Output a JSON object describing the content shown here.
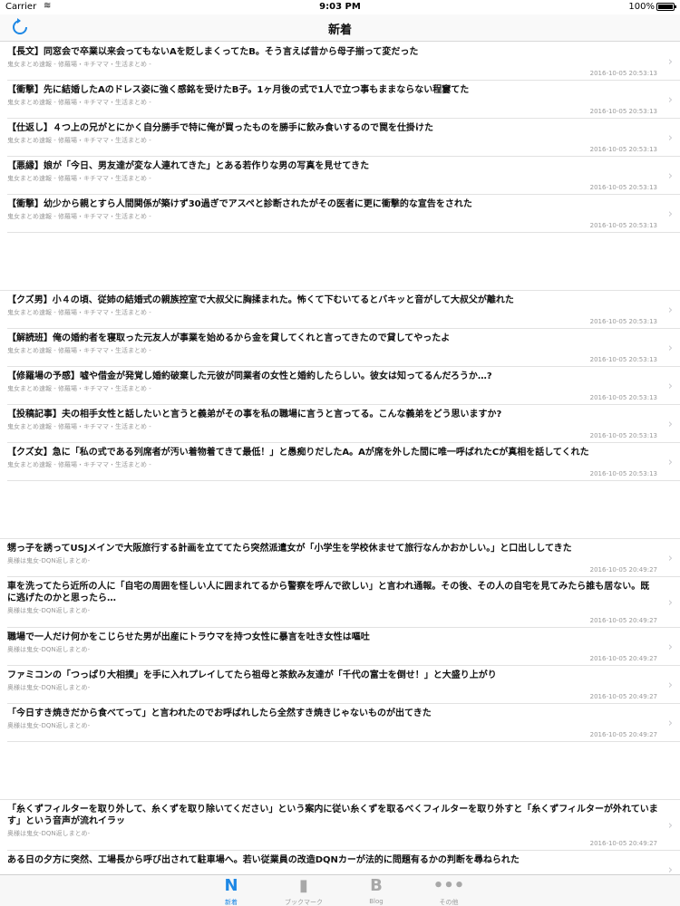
{
  "status": {
    "carrier": "Carrier",
    "time": "9:03 PM",
    "battery": "100%"
  },
  "nav": {
    "title": "新着"
  },
  "sections": [
    {
      "rows": [
        {
          "title": "【長文】同窓会で卒業以来会ってもないAを貶しまくってたB。そう言えば昔から母子揃って変だった",
          "source": "鬼女まとめ速報 - 修羅場・キチママ・生活まとめ -",
          "time": "2016-10-05 20:53:13"
        },
        {
          "title": "【衝撃】先に結婚したAのドレス姿に強く感銘を受けたB子。1ヶ月後の式で1人で立つ事もままならない程窶てた",
          "source": "鬼女まとめ速報 - 修羅場・キチママ・生活まとめ -",
          "time": "2016-10-05 20:53:13"
        },
        {
          "title": "【仕返し】４つ上の兄がとにかく自分勝手で特に俺が買ったものを勝手に飲み食いするので罠を仕掛けた",
          "source": "鬼女まとめ速報 - 修羅場・キチママ・生活まとめ -",
          "time": "2016-10-05 20:53:13"
        },
        {
          "title": "【悪縁】娘が「今日、男友達が変な人連れてきた」とある若作りな男の写真を見せてきた",
          "source": "鬼女まとめ速報 - 修羅場・キチママ・生活まとめ -",
          "time": "2016-10-05 20:53:13"
        },
        {
          "title": "【衝撃】幼少から親とすら人間関係が築けず30過ぎでアスペと診断されたがその医者に更に衝撃的な宣告をされた",
          "source": "鬼女まとめ速報 - 修羅場・キチママ・生活まとめ -",
          "time": "2016-10-05 20:53:13"
        }
      ]
    },
    {
      "rows": [
        {
          "title": "【クズ男】小４の頃、従姉の結婚式の親族控室で大叔父に胸揉まれた。怖くて下むいてるとバキッと音がして大叔父が離れた",
          "source": "鬼女まとめ速報 - 修羅場・キチママ・生活まとめ -",
          "time": "2016-10-05 20:53:13"
        },
        {
          "title": "【解読班】俺の婚約者を寝取った元友人が事業を始めるから金を貸してくれと言ってきたので貸してやったよ",
          "source": "鬼女まとめ速報 - 修羅場・キチママ・生活まとめ -",
          "time": "2016-10-05 20:53:13"
        },
        {
          "title": "【修羅場の予感】嘘や借金が発覚し婚約破棄した元彼が同業者の女性と婚約したらしい。彼女は知ってるんだろうか…?",
          "source": "鬼女まとめ速報 - 修羅場・キチママ・生活まとめ -",
          "time": "2016-10-05 20:53:13"
        },
        {
          "title": "【投稿記事】夫の相手女性と話したいと言うと義弟がその事を私の職場に言うと言ってる。こんな義弟をどう思いますか?",
          "source": "鬼女まとめ速報 - 修羅場・キチママ・生活まとめ -",
          "time": "2016-10-05 20:53:13"
        },
        {
          "title": "【クズ女】急に「私の式である列席者が汚い着物着てきて最低！」と愚痴りだしたA。Aが席を外した間に唯一呼ばれたCが真相を話してくれた",
          "source": "鬼女まとめ速報 - 修羅場・キチママ・生活まとめ -",
          "time": "2016-10-05 20:53:13"
        }
      ]
    },
    {
      "rows": [
        {
          "title": "甥っ子を誘ってUSJメインで大阪旅行する計画を立ててたら突然派遣女が「小学生を学校休ませて旅行なんかおかしい。」と口出ししてきた",
          "source": "奥様は鬼女-DQN返しまとめ-",
          "time": "2016-10-05 20:49:27"
        },
        {
          "title": "車を洗ってたら近所の人に「自宅の周囲を怪しい人に囲まれてるから警察を呼んで欲しい」と言われ通報。その後、その人の自宅を見てみたら誰も居ない。既に逃げたのかと思ったら…",
          "source": "奥様は鬼女-DQN返しまとめ-",
          "time": "2016-10-05 20:49:27",
          "tall": true
        },
        {
          "title": "職場で一人だけ何かをこじらせた男が出産にトラウマを持つ女性に暴言を吐き女性は嘔吐",
          "source": "奥様は鬼女-DQN返しまとめ-",
          "time": "2016-10-05 20:49:27"
        },
        {
          "title": "ファミコンの「つっぱり大相撲」を手に入れプレイしてたら祖母と茶飲み友達が「千代の富士を倒せ！」と大盛り上がり",
          "source": "奥様は鬼女-DQN返しまとめ-",
          "time": "2016-10-05 20:49:27"
        },
        {
          "title": "「今日すき焼きだから食べてって」と言われたのでお呼ばれしたら全然すき焼きじゃないものが出てきた",
          "source": "奥様は鬼女-DQN返しまとめ-",
          "time": "2016-10-05 20:49:27"
        }
      ]
    },
    {
      "rows": [
        {
          "title": "「糸くずフィルターを取り外して、糸くずを取り除いてください」という案内に従い糸くずを取るべくフィルターを取り外すと「糸くずフィルターが外れています」という音声が流れイラッ",
          "source": "奥様は鬼女-DQN返しまとめ-",
          "time": "2016-10-05 20:49:27",
          "tall": true
        },
        {
          "title": "ある日の夕方に突然、工場長から呼び出されて駐車場へ。若い従業員の改造DQNカーが法的に問題有るかの判断を尋ねられた",
          "source": "",
          "time": ""
        }
      ]
    }
  ],
  "tabs": [
    {
      "icon": "N",
      "label": "新着",
      "active": true
    },
    {
      "icon": "▮",
      "label": "ブックマーク"
    },
    {
      "icon": "B",
      "label": "Blog"
    },
    {
      "icon": "•••",
      "label": "その他"
    }
  ],
  "colors": {
    "accent": "#1e88e5",
    "separator": "#e2e2e2",
    "muted": "#999999"
  }
}
